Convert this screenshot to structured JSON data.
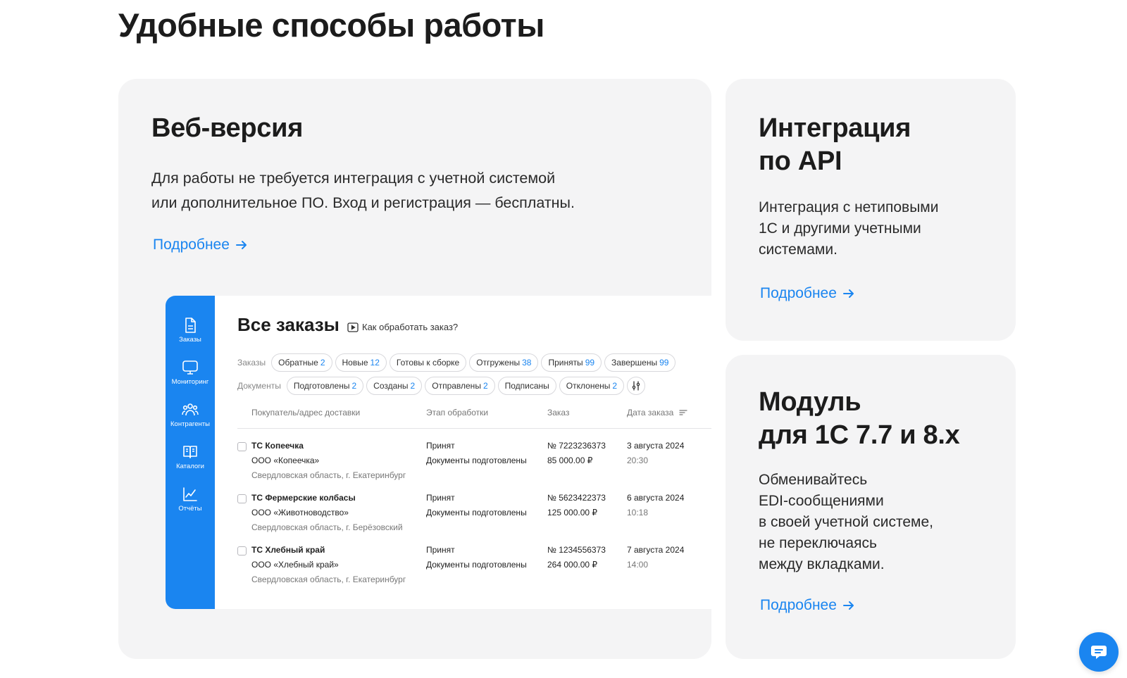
{
  "page": {
    "title": "Удобные способы работы"
  },
  "cards": {
    "web": {
      "title": "Веб-версия",
      "text_line1": "Для работы не требуется интеграция с учетной системой",
      "text_line2": "или дополнительное ПО. Вход и регистрация — бесплатны.",
      "link": "Подробнее"
    },
    "api": {
      "title_line1": "Интеграция",
      "title_line2": "по API",
      "text_line1": "Интеграция с нетиповыми",
      "text_line2": "1С и другими учетными",
      "text_line3": "системами.",
      "link": "Подробнее"
    },
    "module": {
      "title_line1": "Модуль",
      "title_line2": "для 1С 7.7 и 8.х",
      "text_line1": "Обменивайтесь",
      "text_line2": "EDI-сообщениями",
      "text_line3": "в своей учетной системе,",
      "text_line4": "не переключаясь",
      "text_line5": "между вкладками.",
      "link": "Подробнее"
    }
  },
  "mock": {
    "sidebar": {
      "items": [
        {
          "label": "Заказы",
          "icon": "document-icon"
        },
        {
          "label": "Мониторинг",
          "icon": "monitor-icon"
        },
        {
          "label": "Контрагенты",
          "icon": "people-icon"
        },
        {
          "label": "Каталоги",
          "icon": "catalog-icon"
        },
        {
          "label": "Отчёты",
          "icon": "chart-icon"
        }
      ]
    },
    "title": "Все заказы",
    "how_link": "Как обработать заказ?",
    "orders_filters": {
      "label": "Заказы",
      "chips": [
        {
          "label": "Обратные",
          "count": "2"
        },
        {
          "label": "Новые",
          "count": "12"
        },
        {
          "label": "Готовы к сборке",
          "count": ""
        },
        {
          "label": "Отгружены",
          "count": "38"
        },
        {
          "label": "Приняты",
          "count": "99"
        },
        {
          "label": "Завершены",
          "count": "99"
        }
      ]
    },
    "docs_filters": {
      "label": "Документы",
      "chips": [
        {
          "label": "Подготовлены",
          "count": "2"
        },
        {
          "label": "Созданы",
          "count": "2"
        },
        {
          "label": "Отправлены",
          "count": "2"
        },
        {
          "label": "Подписаны",
          "count": ""
        },
        {
          "label": "Отклонены",
          "count": "2"
        }
      ]
    },
    "table": {
      "headers": [
        "Покупатель/адрес доставки",
        "Этап обработки",
        "Заказ",
        "Дата заказа"
      ],
      "rows": [
        {
          "name": "ТС Копеечка",
          "org": "ООО «Копеечка»",
          "address": "Свердловская область, г. Екатеринбург",
          "stage": "Принят",
          "doc_status": "Документы подготовлены",
          "order_no": "№ 7223236373",
          "amount": "85 000.00 ₽",
          "date": "3 августа 2024",
          "time": "20:30"
        },
        {
          "name": "ТС Фермерские колбасы",
          "org": "ООО «Животноводство»",
          "address": "Свердловская область, г. Берёзовский",
          "stage": "Принят",
          "doc_status": "Документы подготовлены",
          "order_no": "№ 5623422373",
          "amount": "125 000.00 ₽",
          "date": "6 августа 2024",
          "time": "10:18"
        },
        {
          "name": "ТС Хлебный край",
          "org": "ООО «Хлебный край»",
          "address": "Свердловская область, г. Екатеринбург",
          "stage": "Принят",
          "doc_status": "Документы подготовлены",
          "order_no": "№ 1234556373",
          "amount": "264 000.00 ₽",
          "date": "7 августа 2024",
          "time": "14:00"
        }
      ]
    }
  },
  "colors": {
    "accent": "#1a85f0",
    "card_bg": "#f4f4f5",
    "text": "#1c1c1c"
  }
}
